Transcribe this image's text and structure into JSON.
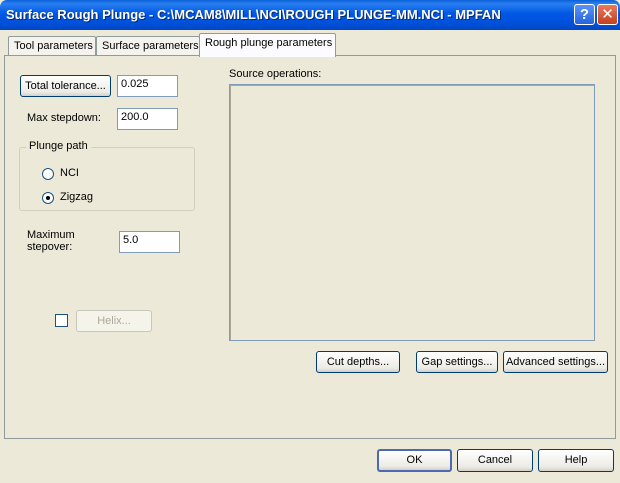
{
  "window": {
    "title": "Surface Rough Plunge - C:\\MCAM8\\MILL\\NCI\\ROUGH PLUNGE-MM.NCI - MPFAN",
    "help_glyph": "?",
    "close_glyph": "✕"
  },
  "tabs": [
    {
      "label": "Tool parameters",
      "active": false
    },
    {
      "label": "Surface parameters",
      "active": false
    },
    {
      "label": "Rough plunge parameters",
      "active": true
    }
  ],
  "params": {
    "total_tolerance_button": "Total tolerance...",
    "total_tolerance_value": "0.025",
    "max_stepdown_label": "Max stepdown:",
    "max_stepdown_value": "200.0",
    "plunge_path": {
      "title": "Plunge path",
      "options": [
        {
          "label": "NCI",
          "selected": false
        },
        {
          "label": "Zigzag",
          "selected": true
        }
      ]
    },
    "max_stepover_label_1": "Maximum",
    "max_stepover_label_2": "stepover:",
    "max_stepover_value": "5.0",
    "helix_button": "Helix...",
    "helix_checked": false
  },
  "source_operations": {
    "label": "Source operations:",
    "items": []
  },
  "panel_buttons": {
    "cut_depths": "Cut depths...",
    "gap_settings": "Gap settings...",
    "advanced_settings": "Advanced settings..."
  },
  "dialog_buttons": {
    "ok": "OK",
    "cancel": "Cancel",
    "help": "Help"
  }
}
